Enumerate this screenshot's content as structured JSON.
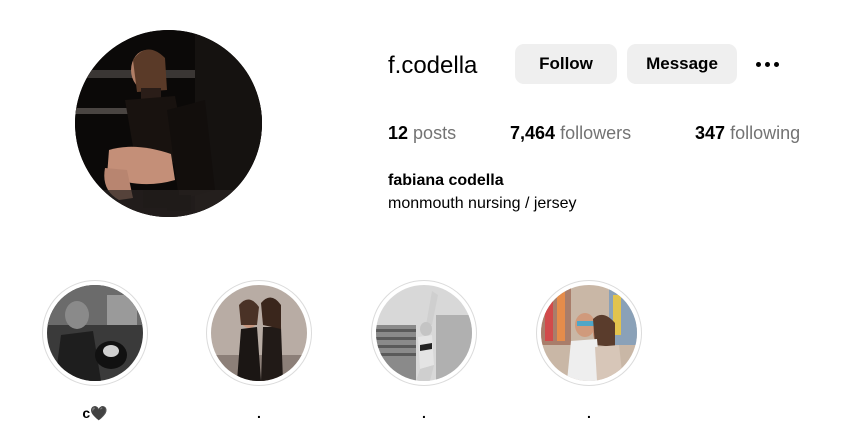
{
  "profile": {
    "username": "f.codella",
    "follow_label": "Follow",
    "message_label": "Message",
    "stats": {
      "posts_count": "12",
      "posts_label": "posts",
      "followers_count": "7,464",
      "followers_label": "followers",
      "following_count": "347",
      "following_label": "following"
    },
    "full_name": "fabiana codella",
    "bio": "monmouth nursing / jersey"
  },
  "highlights": [
    {
      "label": "c🖤"
    },
    {
      "label": "."
    },
    {
      "label": "."
    },
    {
      "label": "."
    }
  ],
  "icons": {
    "more": "more-options-icon"
  },
  "colors": {
    "button_bg": "#efefef",
    "secondary_text": "#737373",
    "highlight_ring": "#dbdbdb"
  }
}
